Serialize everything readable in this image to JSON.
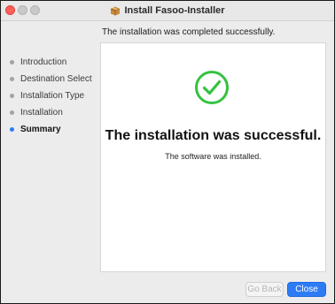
{
  "window": {
    "title": "Install Fasoo-Installer",
    "title_icon": "package-installer-icon"
  },
  "header": {
    "message": "The installation was completed successfully."
  },
  "sidebar": {
    "steps": [
      {
        "label": "Introduction",
        "active": false
      },
      {
        "label": "Destination Select",
        "active": false
      },
      {
        "label": "Installation Type",
        "active": false
      },
      {
        "label": "Installation",
        "active": false
      },
      {
        "label": "Summary",
        "active": true
      }
    ]
  },
  "main": {
    "status_icon": "checkmark-circle-icon",
    "title": "The installation was successful.",
    "subtitle": "The software was installed."
  },
  "buttons": {
    "back_label": "Go Back",
    "close_label": "Close"
  },
  "colors": {
    "success_green": "#34c240",
    "accent_blue": "#2d7cf6",
    "active_dot": "#2f7bf5",
    "inactive_dot": "#a3a3a3"
  }
}
